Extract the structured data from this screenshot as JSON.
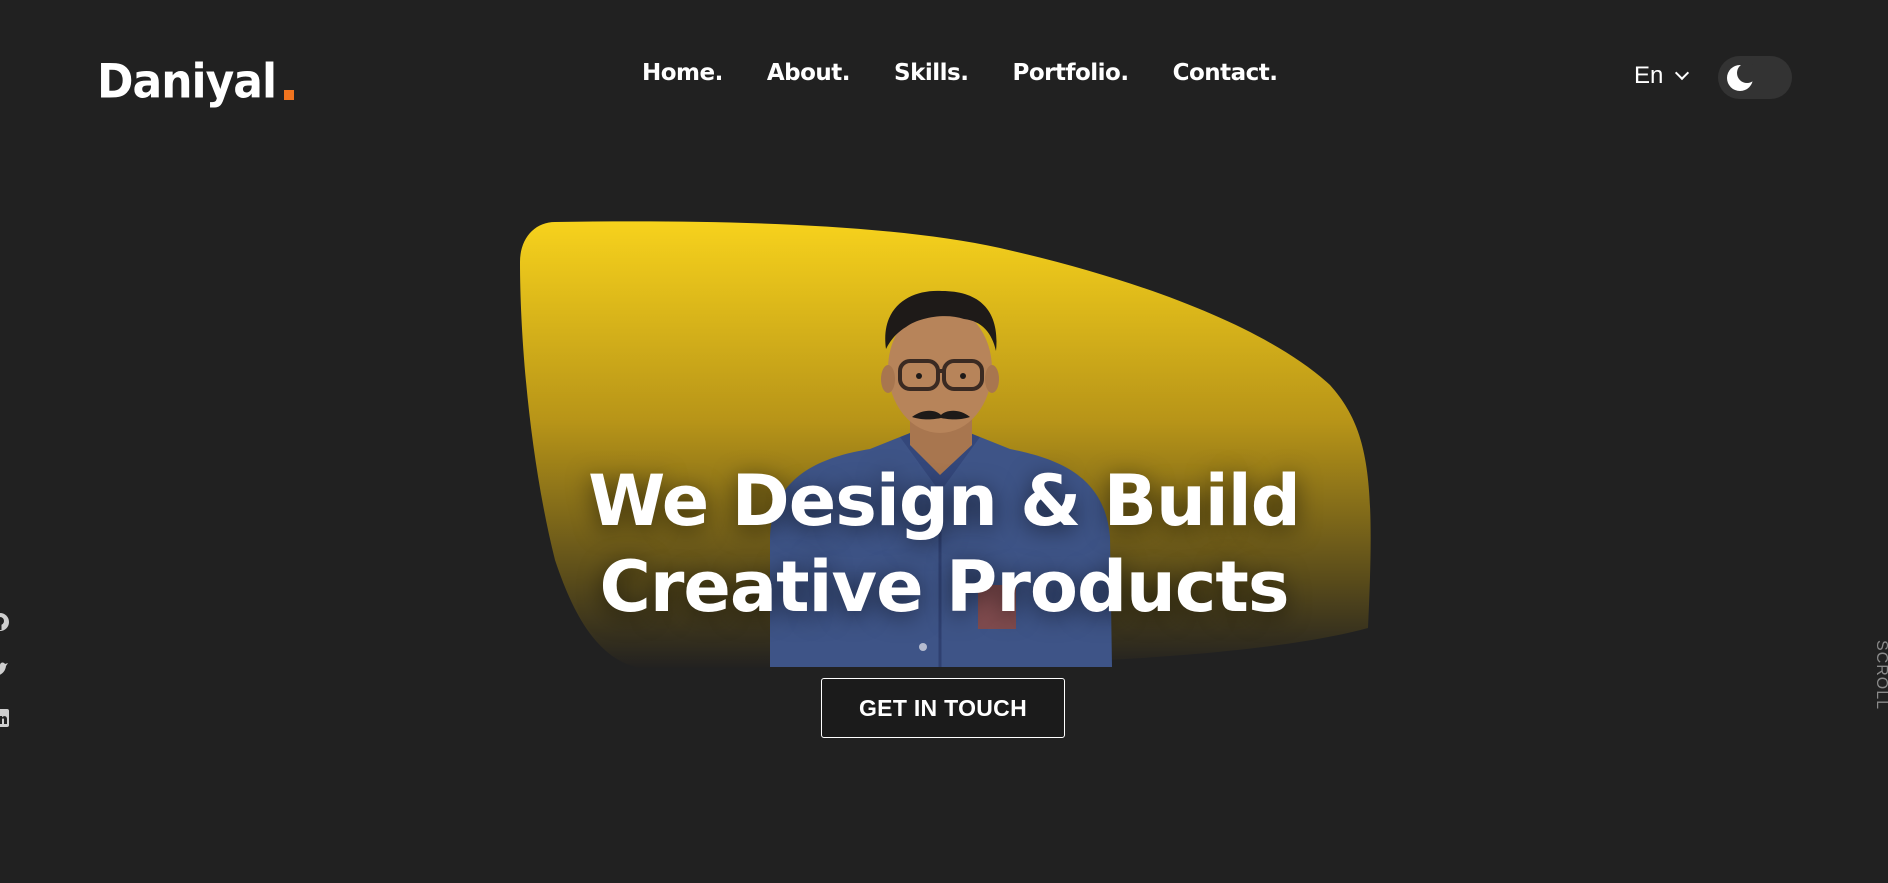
{
  "brand": {
    "name": "Daniyal",
    "accent_color": "#f0741f"
  },
  "nav": {
    "items": [
      {
        "label": "Home."
      },
      {
        "label": "About."
      },
      {
        "label": "Skills."
      },
      {
        "label": "Portfolio."
      },
      {
        "label": "Contact."
      }
    ]
  },
  "language": {
    "selected": "En",
    "icon": "chevron-down-icon"
  },
  "theme_toggle": {
    "icon": "moon-icon",
    "mode": "dark"
  },
  "hero": {
    "headline_line1": "We Design & Build",
    "headline_line2": "Creative Products",
    "cta_label": "GET IN TOUCH",
    "blob_color_top": "#f7d21c",
    "blob_color_bottom": "#212121"
  },
  "socials": [
    {
      "icon": "github-icon"
    },
    {
      "icon": "twitter-icon"
    },
    {
      "icon": "linkedin-icon"
    }
  ],
  "side": {
    "scroll_label": "SCROLL"
  },
  "colors": {
    "background": "#212121",
    "text": "#ffffff"
  }
}
